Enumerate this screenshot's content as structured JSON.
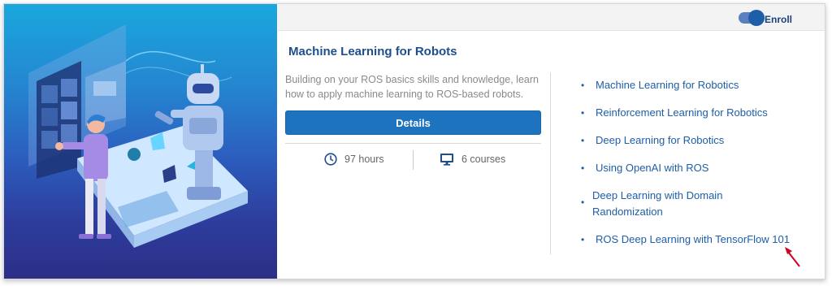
{
  "header": {
    "enroll_label": "Enroll",
    "toggle_on": true
  },
  "course": {
    "title": "Machine Learning for Robots",
    "description": "Building on your ROS basics skills and knowledge, learn how to apply machine learning to ROS-based robots.",
    "details_label": "Details",
    "hours": "97 hours",
    "courses": "6 courses"
  },
  "course_list": [
    "Machine Learning for Robotics",
    "Reinforcement Learning for Robotics",
    "Deep Learning for Robotics",
    "Using OpenAI with ROS",
    "Deep Learning with Domain Randomization",
    "ROS Deep Learning with TensorFlow 101"
  ],
  "bullet": "•",
  "colors": {
    "accent": "#1e73be",
    "link": "#1d5ea8",
    "annotation_arrow": "#d0021b"
  },
  "icons": [
    "clock-icon",
    "monitor-icon",
    "annotation-arrow-icon"
  ]
}
